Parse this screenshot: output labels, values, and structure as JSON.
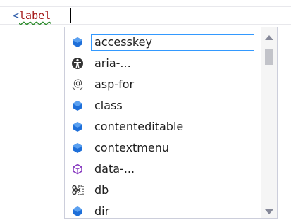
{
  "editor": {
    "open_bracket": "<",
    "tag_name": "label"
  },
  "completion": {
    "items": [
      {
        "label": "accesskey",
        "icon": "attribute-icon"
      },
      {
        "label": "aria-...",
        "icon": "accessibility-icon"
      },
      {
        "label": "asp-for",
        "icon": "tag-helper-icon"
      },
      {
        "label": "class",
        "icon": "attribute-icon"
      },
      {
        "label": "contenteditable",
        "icon": "attribute-icon"
      },
      {
        "label": "contextmenu",
        "icon": "attribute-icon"
      },
      {
        "label": "data-...",
        "icon": "data-attribute-icon"
      },
      {
        "label": "db",
        "icon": "snippet-icon"
      },
      {
        "label": "dir",
        "icon": "attribute-icon"
      }
    ],
    "selected_label": "accesskey"
  },
  "colors": {
    "attribute": "#1e6fd9",
    "data_attribute": "#8b3fc2",
    "selection_border": "#3399ff"
  }
}
